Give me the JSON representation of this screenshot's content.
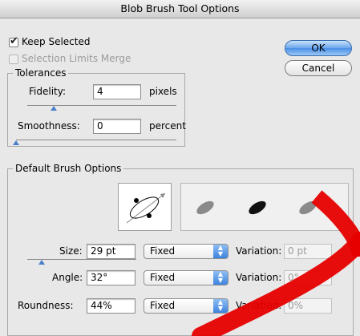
{
  "window": {
    "title": "Blob Brush Tool Options"
  },
  "options": {
    "keep_selected": {
      "label": "Keep Selected",
      "checked": true
    },
    "selection_limits_merge": {
      "label": "Selection Limits Merge",
      "checked": false,
      "disabled": true
    }
  },
  "buttons": {
    "ok": "OK",
    "cancel": "Cancel"
  },
  "tolerances": {
    "title": "Tolerances",
    "fidelity": {
      "label": "Fidelity:",
      "value": "4",
      "unit": "pixels",
      "slider_fraction": 0.25
    },
    "smoothness": {
      "label": "Smoothness:",
      "value": "0",
      "unit": "percent",
      "slider_fraction": 0.0
    }
  },
  "brush": {
    "title": "Default Brush Options",
    "size": {
      "label": "Size:",
      "value": "29 pt",
      "mode": "Fixed",
      "variation_label": "Variation:",
      "variation_value": "0 pt",
      "slider_fraction": 0.2
    },
    "angle": {
      "label": "Angle:",
      "value": "32°",
      "mode": "Fixed",
      "variation_label": "Variation:",
      "variation_value": "0°"
    },
    "roundness": {
      "label": "Roundness:",
      "value": "44%",
      "mode": "Fixed",
      "variation_label": "Variation:",
      "variation_value": "0%"
    }
  },
  "colors": {
    "accent": "#4a8fe6",
    "watermark": "#e60000",
    "preview_blob_gray": "#8a8a8a",
    "preview_blob_dark": "#111111"
  }
}
